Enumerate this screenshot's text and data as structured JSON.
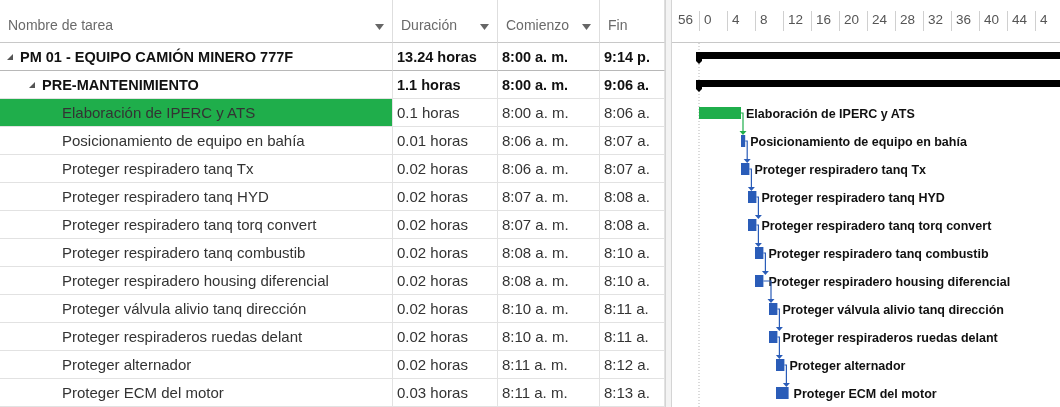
{
  "columns": [
    {
      "label": "Nombre de tarea",
      "menu": true
    },
    {
      "label": "Duración",
      "menu": true
    },
    {
      "label": "Comienzo",
      "menu": true
    },
    {
      "label": "Fin",
      "menu": false
    }
  ],
  "timescale": [
    "56",
    "0",
    "4",
    "8",
    "12",
    "16",
    "20",
    "24",
    "28",
    "32",
    "36",
    "40",
    "44",
    "4"
  ],
  "tasks": [
    {
      "kind": "summary",
      "name": "PM 01 - EQUIPO CAMIÓN MINERO 777F",
      "expanded": true,
      "selected": false,
      "duration": "13.24 horas",
      "start": "8:00 a. m.",
      "finish": "9:14 p.",
      "children": [
        {
          "kind": "summary",
          "name": "PRE-MANTENIMIENTO",
          "expanded": true,
          "selected": false,
          "duration": "1.1 horas",
          "start": "8:00 a. m.",
          "finish": "9:06 a.",
          "children": [
            {
              "kind": "task",
              "name": "Elaboración de IPERC y ATS",
              "selected": true,
              "duration": "0.1 horas",
              "start": "8:00 a. m.",
              "finish": "8:06 a.",
              "color": "#1fae4b",
              "bar_label": "Elaboración de IPERC y ATS"
            },
            {
              "kind": "task",
              "name": "Posicionamiento de equipo en bahía",
              "selected": false,
              "duration": "0.01 horas",
              "start": "8:06 a. m.",
              "finish": "8:07 a.",
              "color": "#2a5cb8",
              "bar_label": "Posicionamiento de equipo en bahía"
            },
            {
              "kind": "task",
              "name": "Proteger respiradero tanq Tx",
              "selected": false,
              "duration": "0.02 horas",
              "start": "8:06 a. m.",
              "finish": "8:07 a.",
              "color": "#2a5cb8",
              "bar_label": "Proteger respiradero tanq Tx"
            },
            {
              "kind": "task",
              "name": "Proteger respiradero tanq HYD",
              "selected": false,
              "duration": "0.02 horas",
              "start": "8:07 a. m.",
              "finish": "8:08 a.",
              "color": "#2a5cb8",
              "bar_label": "Proteger respiradero tanq HYD"
            },
            {
              "kind": "task",
              "name": "Proteger respiradero tanq torq convert",
              "selected": false,
              "duration": "0.02 horas",
              "start": "8:07 a. m.",
              "finish": "8:08 a.",
              "color": "#2a5cb8",
              "bar_label": "Proteger respiradero tanq torq convert"
            },
            {
              "kind": "task",
              "name": "Proteger respiradero tanq combustib",
              "selected": false,
              "duration": "0.02 horas",
              "start": "8:08 a. m.",
              "finish": "8:10 a.",
              "color": "#2a5cb8",
              "bar_label": "Proteger respiradero tanq combustib"
            },
            {
              "kind": "task",
              "name": "Proteger respiradero housing diferencial",
              "selected": false,
              "duration": "0.02 horas",
              "start": "8:08 a. m.",
              "finish": "8:10 a.",
              "color": "#2a5cb8",
              "bar_label": "Proteger respiradero housing diferencial"
            },
            {
              "kind": "task",
              "name": "Proteger válvula alivio tanq dirección",
              "selected": false,
              "duration": "0.02 horas",
              "start": "8:10 a. m.",
              "finish": "8:11 a.",
              "color": "#2a5cb8",
              "bar_label": "Proteger válvula alivio tanq dirección"
            },
            {
              "kind": "task",
              "name": "Proteger respiraderos ruedas delant",
              "selected": false,
              "duration": "0.02 horas",
              "start": "8:10 a. m.",
              "finish": "8:11 a.",
              "color": "#2a5cb8",
              "bar_label": "Proteger respiraderos ruedas delant"
            },
            {
              "kind": "task",
              "name": "Proteger alternador",
              "selected": false,
              "duration": "0.02 horas",
              "start": "8:11 a. m.",
              "finish": "8:12 a.",
              "color": "#2a5cb8",
              "bar_label": "Proteger alternador"
            },
            {
              "kind": "task",
              "name": "Proteger ECM del motor",
              "selected": false,
              "duration": "0.03 horas",
              "start": "8:11 a. m.",
              "finish": "8:13 a.",
              "color": "#2a5cb8",
              "bar_label": "Proteger ECM del motor"
            }
          ]
        }
      ]
    }
  ]
}
